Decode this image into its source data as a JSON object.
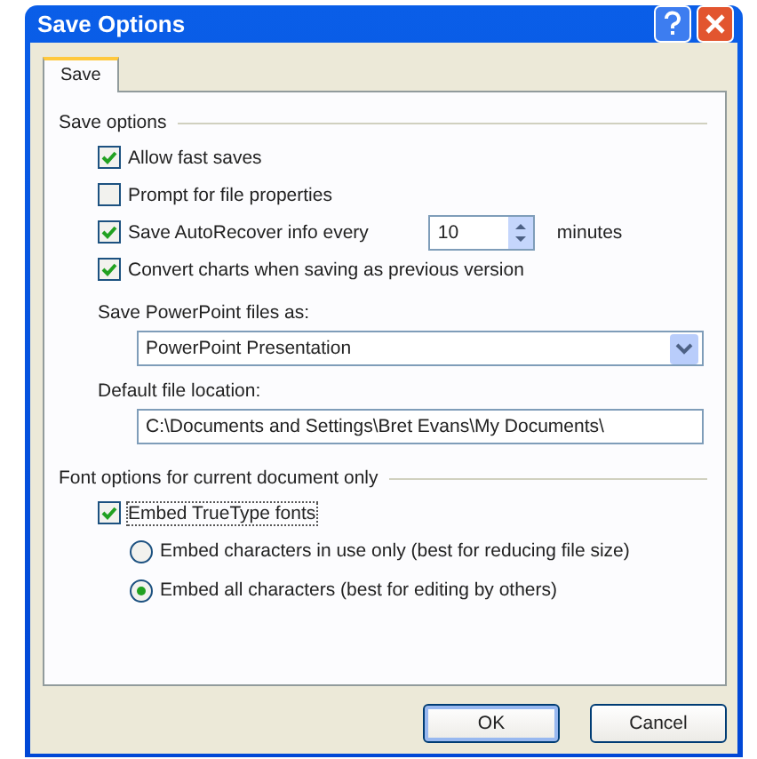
{
  "window": {
    "title": "Save Options"
  },
  "tabs": [
    {
      "label": "Save",
      "selected": true
    }
  ],
  "save_options": {
    "heading": "Save options",
    "items": [
      {
        "kind": "checkbox",
        "label": "Allow fast saves",
        "checked": true
      },
      {
        "kind": "checkbox",
        "label": "Prompt for file properties",
        "checked": false
      },
      {
        "kind": "spin",
        "label": "Save AutoRecover info every",
        "checked": true,
        "value": "10",
        "unit": "minutes"
      },
      {
        "kind": "checkbox",
        "label": "Convert charts when saving as previous version",
        "checked": true
      }
    ],
    "format": {
      "label": "Save PowerPoint files as:",
      "value": "PowerPoint Presentation"
    },
    "location": {
      "label": "Default file location:",
      "value": "C:\\Documents and Settings\\Bret Evans\\My Documents\\"
    }
  },
  "font_options": {
    "heading": "Font options for current document only",
    "embed": {
      "label": "Embed TrueType fonts",
      "checked": true
    },
    "radios": [
      {
        "label": "Embed characters in use only (best for reducing file size)",
        "selected": false
      },
      {
        "label": "Embed all characters (best for editing by others)",
        "selected": true
      }
    ]
  },
  "buttons": [
    "OK",
    "Cancel"
  ]
}
